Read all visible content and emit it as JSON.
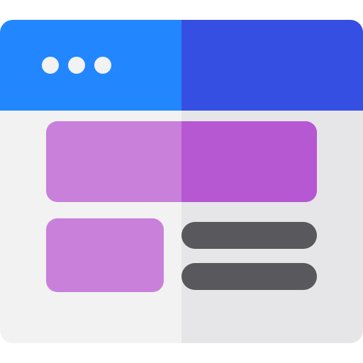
{
  "icon": {
    "name": "web-page-layout-icon",
    "colors": {
      "titlebar_left": "#2286ff",
      "titlebar_right": "#354fe3",
      "body_left": "#f2f2f3",
      "body_right": "#e6e6e8",
      "dots": "#f2f2f3",
      "banner_left": "#c880db",
      "banner_right": "#b558d2",
      "thumbnail": "#c880db",
      "text_lines": "#58585d"
    },
    "window_dots": 3,
    "text_lines": 2
  }
}
